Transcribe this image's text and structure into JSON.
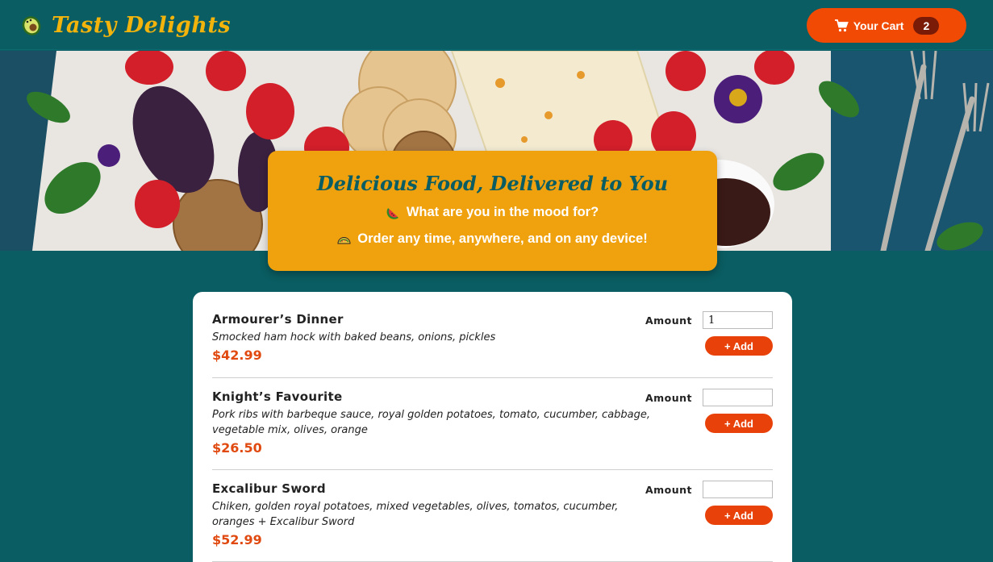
{
  "header": {
    "title": "Tasty Delights",
    "cart": {
      "label": "Your Cart",
      "count": "2"
    }
  },
  "banner": {
    "title": "Delicious Food, Delivered to You",
    "line1": "What are you in the mood for?",
    "line2": "Order any time, anywhere, and on any device!"
  },
  "menu": {
    "amount_label": "Amount",
    "add_label": "+ Add",
    "items": [
      {
        "name": "Armourer’s Dinner",
        "description": "Smocked ham hock with baked beans, onions, pickles",
        "price": "$42.99",
        "amount": "1"
      },
      {
        "name": "Knight’s Favourite",
        "description": "Pork ribs with barbeque sauce, royal golden potatoes, tomato, cucumber, cabbage, vegetable mix, olives, orange",
        "price": "$26.50",
        "amount": ""
      },
      {
        "name": "Excalibur Sword",
        "description": "Chiken, golden royal potatoes, mixed vegetables, olives, tomatos, cucumber, oranges + Excalibur Sword",
        "price": "$52.99",
        "amount": ""
      }
    ]
  },
  "colors": {
    "teal": "#0a5d62",
    "accent_orange": "#f04a05",
    "gold": "#f0a10e",
    "price": "#e04a10"
  },
  "icons": [
    "avocado-logo-icon",
    "cart-icon",
    "watermelon-icon",
    "taco-icon"
  ]
}
